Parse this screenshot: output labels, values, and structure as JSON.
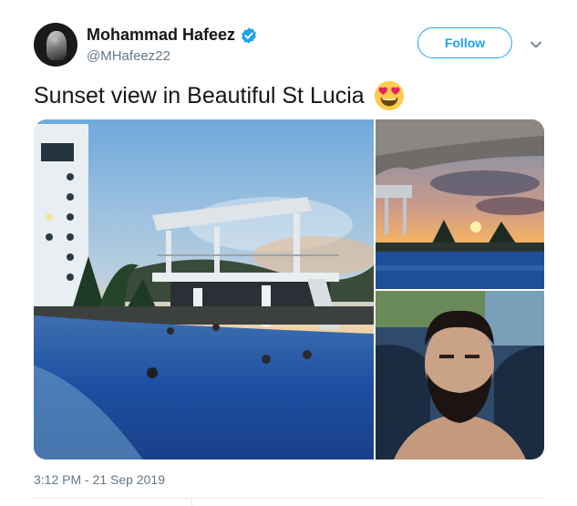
{
  "tweet": {
    "author": {
      "display_name": "Mohammad Hafeez",
      "handle": "@MHafeez22",
      "verified_icon": "verified-badge-icon"
    },
    "follow_label": "Follow",
    "menu_icon": "chevron-down-icon",
    "text": "Sunset view in Beautiful St Lucia",
    "emoji": "heart-eyes-emoji-icon",
    "media": [
      {
        "kind": "photo",
        "subject": "pool-sunset"
      },
      {
        "kind": "photo",
        "subject": "infinity-pool-umbrella"
      },
      {
        "kind": "photo",
        "subject": "selfie"
      }
    ],
    "timestamp": "3:12 PM - 21 Sep 2019"
  },
  "colors": {
    "accent": "#1da1f2",
    "text_primary": "#14171a",
    "text_secondary": "#657786",
    "divider": "#e6ecf0"
  }
}
